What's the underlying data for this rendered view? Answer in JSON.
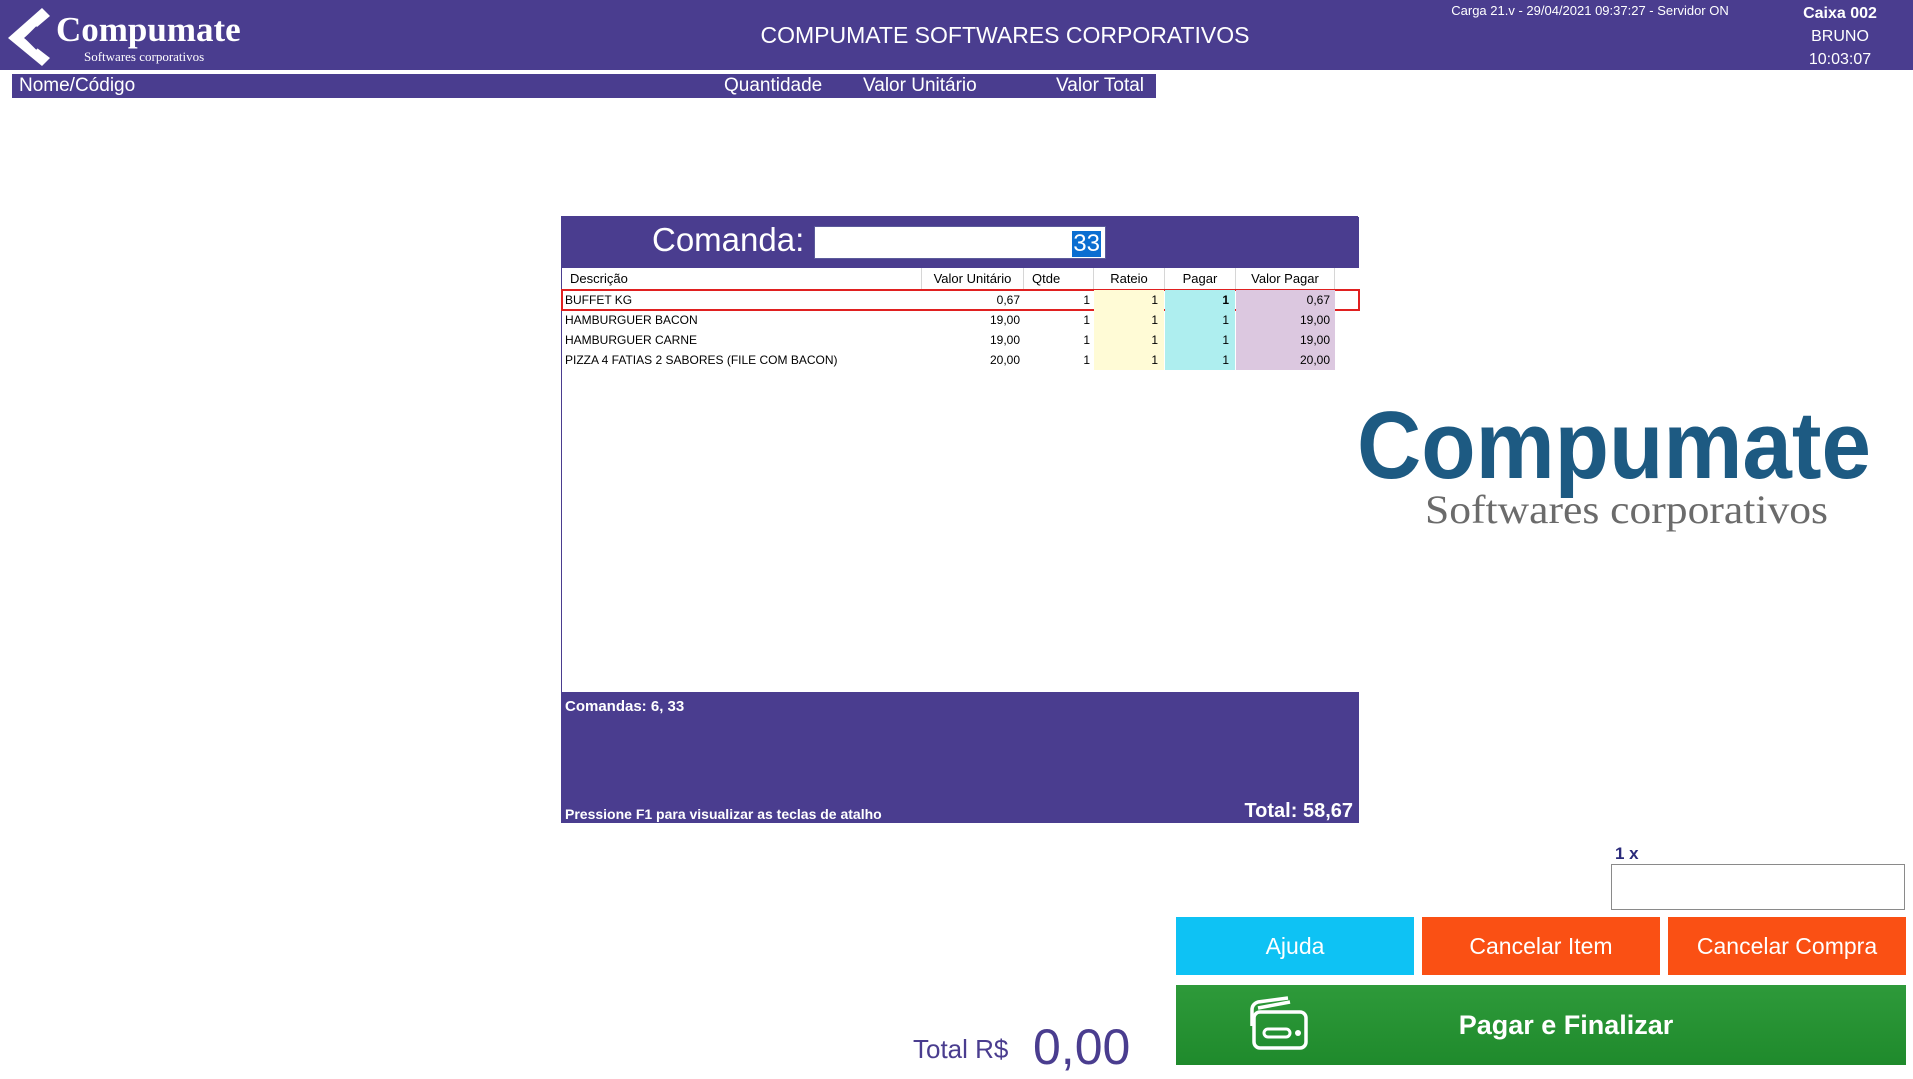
{
  "header": {
    "brand_name": "Compumate",
    "brand_tagline": "Softwares corporativos",
    "title": "COMPUMATE SOFTWARES CORPORATIVOS",
    "server_info": "Carga 21.v - 29/04/2021 09:37:27 - Servidor ON",
    "caixa": "Caixa 002",
    "operator": "BRUNO",
    "time": "10:03:07"
  },
  "items_header": {
    "name_code": "Nome/Código",
    "quantity": "Quantidade",
    "unit_value": "Valor Unitário",
    "total_value": "Valor Total"
  },
  "dialog": {
    "comanda_label": "Comanda:",
    "comanda_value": "33",
    "columns": {
      "descricao": "Descrição",
      "valor_unitario": "Valor Unitário",
      "qtde": "Qtde",
      "rateio": "Rateio",
      "pagar": "Pagar",
      "valor_pagar": "Valor Pagar"
    },
    "rows": [
      {
        "descricao": "BUFFET KG",
        "valor_unitario": "0,67",
        "qtde": "1",
        "rateio": "1",
        "pagar": "1",
        "valor_pagar": "0,67"
      },
      {
        "descricao": "HAMBURGUER BACON",
        "valor_unitario": "19,00",
        "qtde": "1",
        "rateio": "1",
        "pagar": "1",
        "valor_pagar": "19,00"
      },
      {
        "descricao": "HAMBURGUER CARNE",
        "valor_unitario": "19,00",
        "qtde": "1",
        "rateio": "1",
        "pagar": "1",
        "valor_pagar": "19,00"
      },
      {
        "descricao": "PIZZA 4 FATIAS 2 SABORES (FILE COM BACON)",
        "valor_unitario": "20,00",
        "qtde": "1",
        "rateio": "1",
        "pagar": "1",
        "valor_pagar": "20,00"
      }
    ],
    "comandas_list": "Comandas: 6, 33",
    "hint": "Pressione F1 para visualizar as teclas de atalho",
    "total": "Total: 58,67"
  },
  "big_logo": {
    "name": "Compumate",
    "tagline": "Softwares corporativos"
  },
  "multiplier_label": "1 x",
  "buttons": {
    "ajuda": "Ajuda",
    "cancelar_item": "Cancelar Item",
    "cancelar_compra": "Cancelar Compra",
    "pagar_finalizar": "Pagar e Finalizar"
  },
  "total": {
    "label": "Total R$",
    "value": "0,00"
  },
  "colors": {
    "primary": "#4a3d8f",
    "help": "#0ec2f4",
    "cancel": "#fa5014",
    "pay": "#279432",
    "logo_blue": "#1d5a82",
    "logo_gray": "#6b6b6b"
  },
  "icons": {
    "logo_mark": "chevron-logo-icon",
    "pay": "credit-card-icon"
  }
}
